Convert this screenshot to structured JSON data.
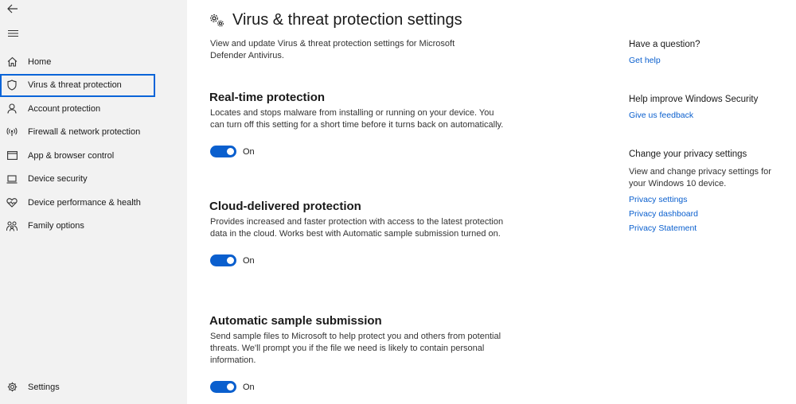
{
  "sidebar": {
    "items": [
      {
        "id": "home",
        "label": "Home",
        "icon": "home-icon"
      },
      {
        "id": "virus",
        "label": "Virus & threat protection",
        "icon": "shield-icon",
        "active": true
      },
      {
        "id": "account",
        "label": "Account protection",
        "icon": "person-icon"
      },
      {
        "id": "firewall",
        "label": "Firewall & network protection",
        "icon": "wifi-signal-icon"
      },
      {
        "id": "app",
        "label": "App & browser control",
        "icon": "app-window-icon"
      },
      {
        "id": "device",
        "label": "Device security",
        "icon": "laptop-icon"
      },
      {
        "id": "performance",
        "label": "Device performance & health",
        "icon": "heart-icon"
      },
      {
        "id": "family",
        "label": "Family options",
        "icon": "family-icon"
      }
    ],
    "settings_label": "Settings"
  },
  "main": {
    "title": "Virus & threat protection settings",
    "description": "View and update Virus & threat protection settings for Microsoft Defender Antivirus.",
    "sections": [
      {
        "title": "Real-time protection",
        "description": "Locates and stops malware from installing or running on your device. You can turn off this setting for a short time before it turns back on automatically.",
        "toggle_label": "On"
      },
      {
        "title": "Cloud-delivered protection",
        "description": "Provides increased and faster protection with access to the latest protection data in the cloud. Works best with Automatic sample submission turned on.",
        "toggle_label": "On"
      },
      {
        "title": "Automatic sample submission",
        "description": "Send sample files to Microsoft to help protect you and others from potential threats. We'll prompt you if the file we need is likely to contain personal information.",
        "toggle_label": "On"
      }
    ]
  },
  "aside": {
    "question": {
      "title": "Have a question?",
      "link": "Get help"
    },
    "improve": {
      "title": "Help improve Windows Security",
      "link": "Give us feedback"
    },
    "privacy": {
      "title": "Change your privacy settings",
      "text": "View and change privacy settings for your Windows 10 device.",
      "links": [
        "Privacy settings",
        "Privacy dashboard",
        "Privacy Statement"
      ]
    }
  },
  "colors": {
    "accent": "#0a5fce",
    "sidebar_bg": "#f2f2f2",
    "active_outline": "#0a64d8"
  }
}
